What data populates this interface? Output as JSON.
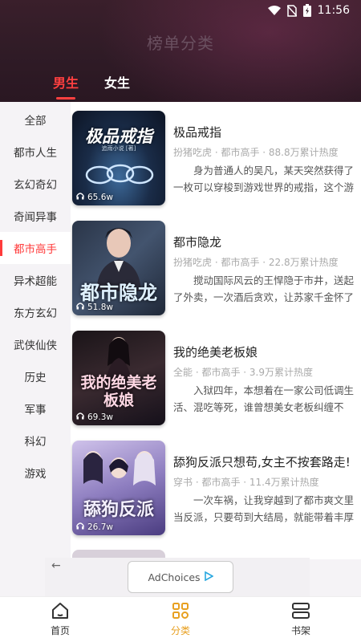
{
  "status_bar": {
    "time": "11:56"
  },
  "header": {
    "title": "榜单分类"
  },
  "gender_tabs": [
    {
      "label": "男生",
      "active": true
    },
    {
      "label": "女生",
      "active": false
    }
  ],
  "categories": [
    {
      "label": "全部"
    },
    {
      "label": "都市人生"
    },
    {
      "label": "玄幻奇幻"
    },
    {
      "label": "奇闻异事"
    },
    {
      "label": "都市高手",
      "active": true
    },
    {
      "label": "异术超能"
    },
    {
      "label": "东方玄幻"
    },
    {
      "label": "武侠仙侠"
    },
    {
      "label": "历史"
    },
    {
      "label": "军事"
    },
    {
      "label": "科幻"
    },
    {
      "label": "游戏"
    }
  ],
  "books": [
    {
      "cover_text": "极品戒指",
      "cover_sub": "追雨小说 [著]",
      "listens": "65.6w",
      "title": "极品戒指",
      "meta": "扮猪吃虎 · 都市高手 · 88.8万累计热度",
      "desc": "身为普通人的吴凡，某天突然获得了一枚可以穿梭到游戏世界的戒指，这个游戏…"
    },
    {
      "cover_text": "都市隐龙",
      "cover_sub": "",
      "listens": "51.8w",
      "title": "都市隐龙",
      "meta": "扮猪吃虎 · 都市高手 · 22.8万累计热度",
      "desc": "搅动国际风云的王悍隐于市井，送起了外卖，一次酒后贪欢，让苏家千金怀了孕…"
    },
    {
      "cover_text": "我的绝美老板娘",
      "cover_sub": "",
      "listens": "69.3w",
      "title": "我的绝美老板娘",
      "meta": "全能 · 都市高手 · 3.9万累计热度",
      "desc": "入狱四年，本想着在一家公司低调生活、混吃等死，谁曾想美女老板纠缠不断…"
    },
    {
      "cover_text": "舔狗反派",
      "cover_sub": "",
      "listens": "26.7w",
      "title": "舔狗反派只想苟,女主不按套路走!",
      "meta": "穿书 · 都市高手 · 11.4万累计热度",
      "desc": "一次车祸，让我穿越到了都市爽文里当反派，只要苟到大结局，就能带着丰厚的…"
    }
  ],
  "ad": {
    "label": "AdChoices"
  },
  "bottom_nav": [
    {
      "label": "首页",
      "icon": "home-icon",
      "active": false
    },
    {
      "label": "分类",
      "icon": "category-icon",
      "active": true
    },
    {
      "label": "书架",
      "icon": "bookshelf-icon",
      "active": false
    }
  ],
  "colors": {
    "accent_red": "#ff3b3b",
    "nav_active": "#e8a020",
    "header_bg": "#2f1b26"
  }
}
